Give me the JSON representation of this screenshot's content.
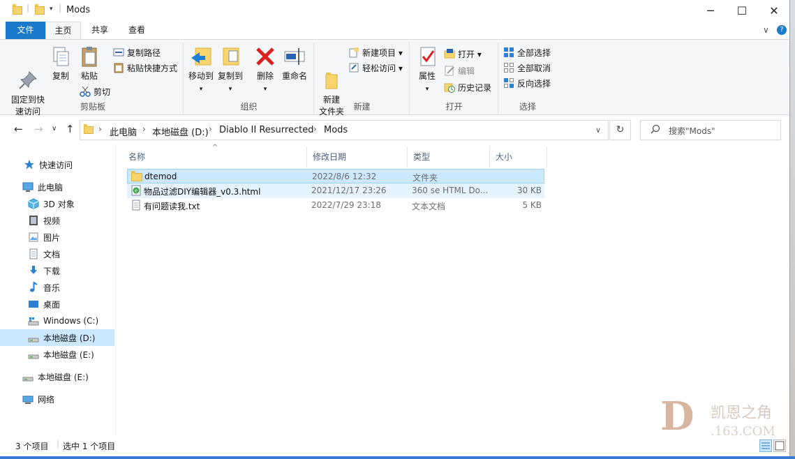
{
  "window": {
    "title": "Mods",
    "minimize": "─",
    "maximize": "☐",
    "close": "✕"
  },
  "tabs": {
    "file": "文件",
    "home": "主页",
    "share": "共享",
    "view": "查看",
    "collapse": "∨",
    "help": "?"
  },
  "ribbon": {
    "clipboard": {
      "label": "剪贴板",
      "pin": "固定到快\n速访问",
      "copy": "复制",
      "paste": "粘贴",
      "copy_path": "复制路径",
      "paste_shortcut": "粘贴快捷方式",
      "cut": "剪切"
    },
    "organize": {
      "label": "组织",
      "move_to": "移动到",
      "copy_to": "复制到",
      "delete": "删除",
      "rename": "重命名"
    },
    "new": {
      "label": "新建",
      "new_folder": "新建\n文件夹",
      "new_item": "新建项目 ▾",
      "easy_access": "轻松访问 ▾"
    },
    "open": {
      "label": "打开",
      "properties": "属性",
      "open": "打开 ▾",
      "edit": "编辑",
      "history": "历史记录"
    },
    "select": {
      "label": "选择",
      "select_all": "全部选择",
      "select_none": "全部取消",
      "invert": "反向选择"
    }
  },
  "address": {
    "crumbs": [
      "此电脑",
      "本地磁盘 (D:)",
      "Diablo II Resurrected",
      "Mods"
    ],
    "search_placeholder": "搜索\"Mods\""
  },
  "nav": {
    "quick_access": "快速访问",
    "this_pc": "此电脑",
    "objects3d": "3D 对象",
    "videos": "视频",
    "pictures": "图片",
    "documents": "文档",
    "downloads": "下载",
    "music": "音乐",
    "desktop": "桌面",
    "drive_c": "Windows (C:)",
    "drive_d": "本地磁盘 (D:)",
    "drive_e": "本地磁盘 (E:)",
    "drive_e2": "本地磁盘 (E:)",
    "network": "网络"
  },
  "columns": {
    "name": "名称",
    "date": "修改日期",
    "type": "类型",
    "size": "大小"
  },
  "files": [
    {
      "name": "dtemod",
      "date": "2022/8/6 12:32",
      "type": "文件夹",
      "size": ""
    },
    {
      "name": "物品过滤DIY编辑器_v0.3.html",
      "date": "2021/12/17 23:26",
      "type": "360 se HTML Do...",
      "size": "30 KB"
    },
    {
      "name": "有问题读我.txt",
      "date": "2022/7/29 23:18",
      "type": "文本文档",
      "size": "5 KB"
    }
  ],
  "status": {
    "count": "3 个项目",
    "selected": "选中 1 个项目"
  },
  "watermark": {
    "letter": "D",
    "line1": "凯恩之角",
    ".163.COM": ".163.COM",
    "line2": ".163.COM"
  },
  "colors": {
    "accent": "#1979ca",
    "selection": "#cce8ff",
    "folder": "#f7d56e"
  }
}
